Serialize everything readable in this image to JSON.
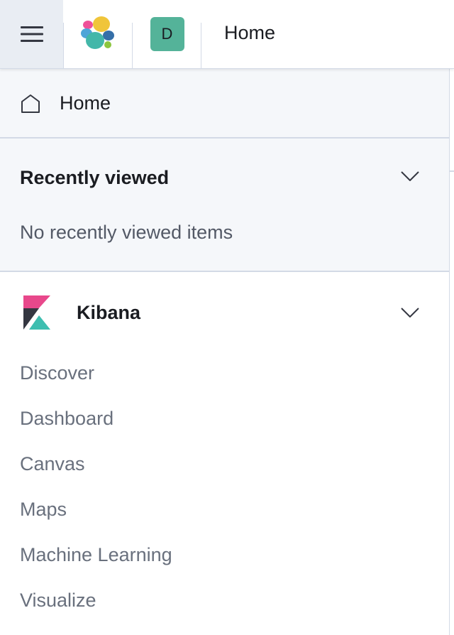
{
  "header": {
    "menu_icon": "hamburger-menu-icon",
    "logo_icon": "elastic-logo-icon",
    "avatar_initial": "D",
    "avatar_color": "#54b399",
    "breadcrumb": "Home"
  },
  "nav": {
    "home": {
      "icon": "home-icon",
      "label": "Home"
    },
    "recently_viewed": {
      "title": "Recently viewed",
      "empty_text": "No recently viewed items",
      "chevron_icon": "chevron-down-icon"
    },
    "kibana": {
      "icon": "kibana-logo-icon",
      "title": "Kibana",
      "chevron_icon": "chevron-down-icon",
      "links": [
        "Discover",
        "Dashboard",
        "Canvas",
        "Maps",
        "Machine Learning",
        "Visualize"
      ]
    }
  },
  "colors": {
    "accent": "#54b399",
    "text": "#1a1c21",
    "subdued": "#69707d",
    "panel_bg": "#f5f7fa",
    "border": "#d3dae6"
  }
}
